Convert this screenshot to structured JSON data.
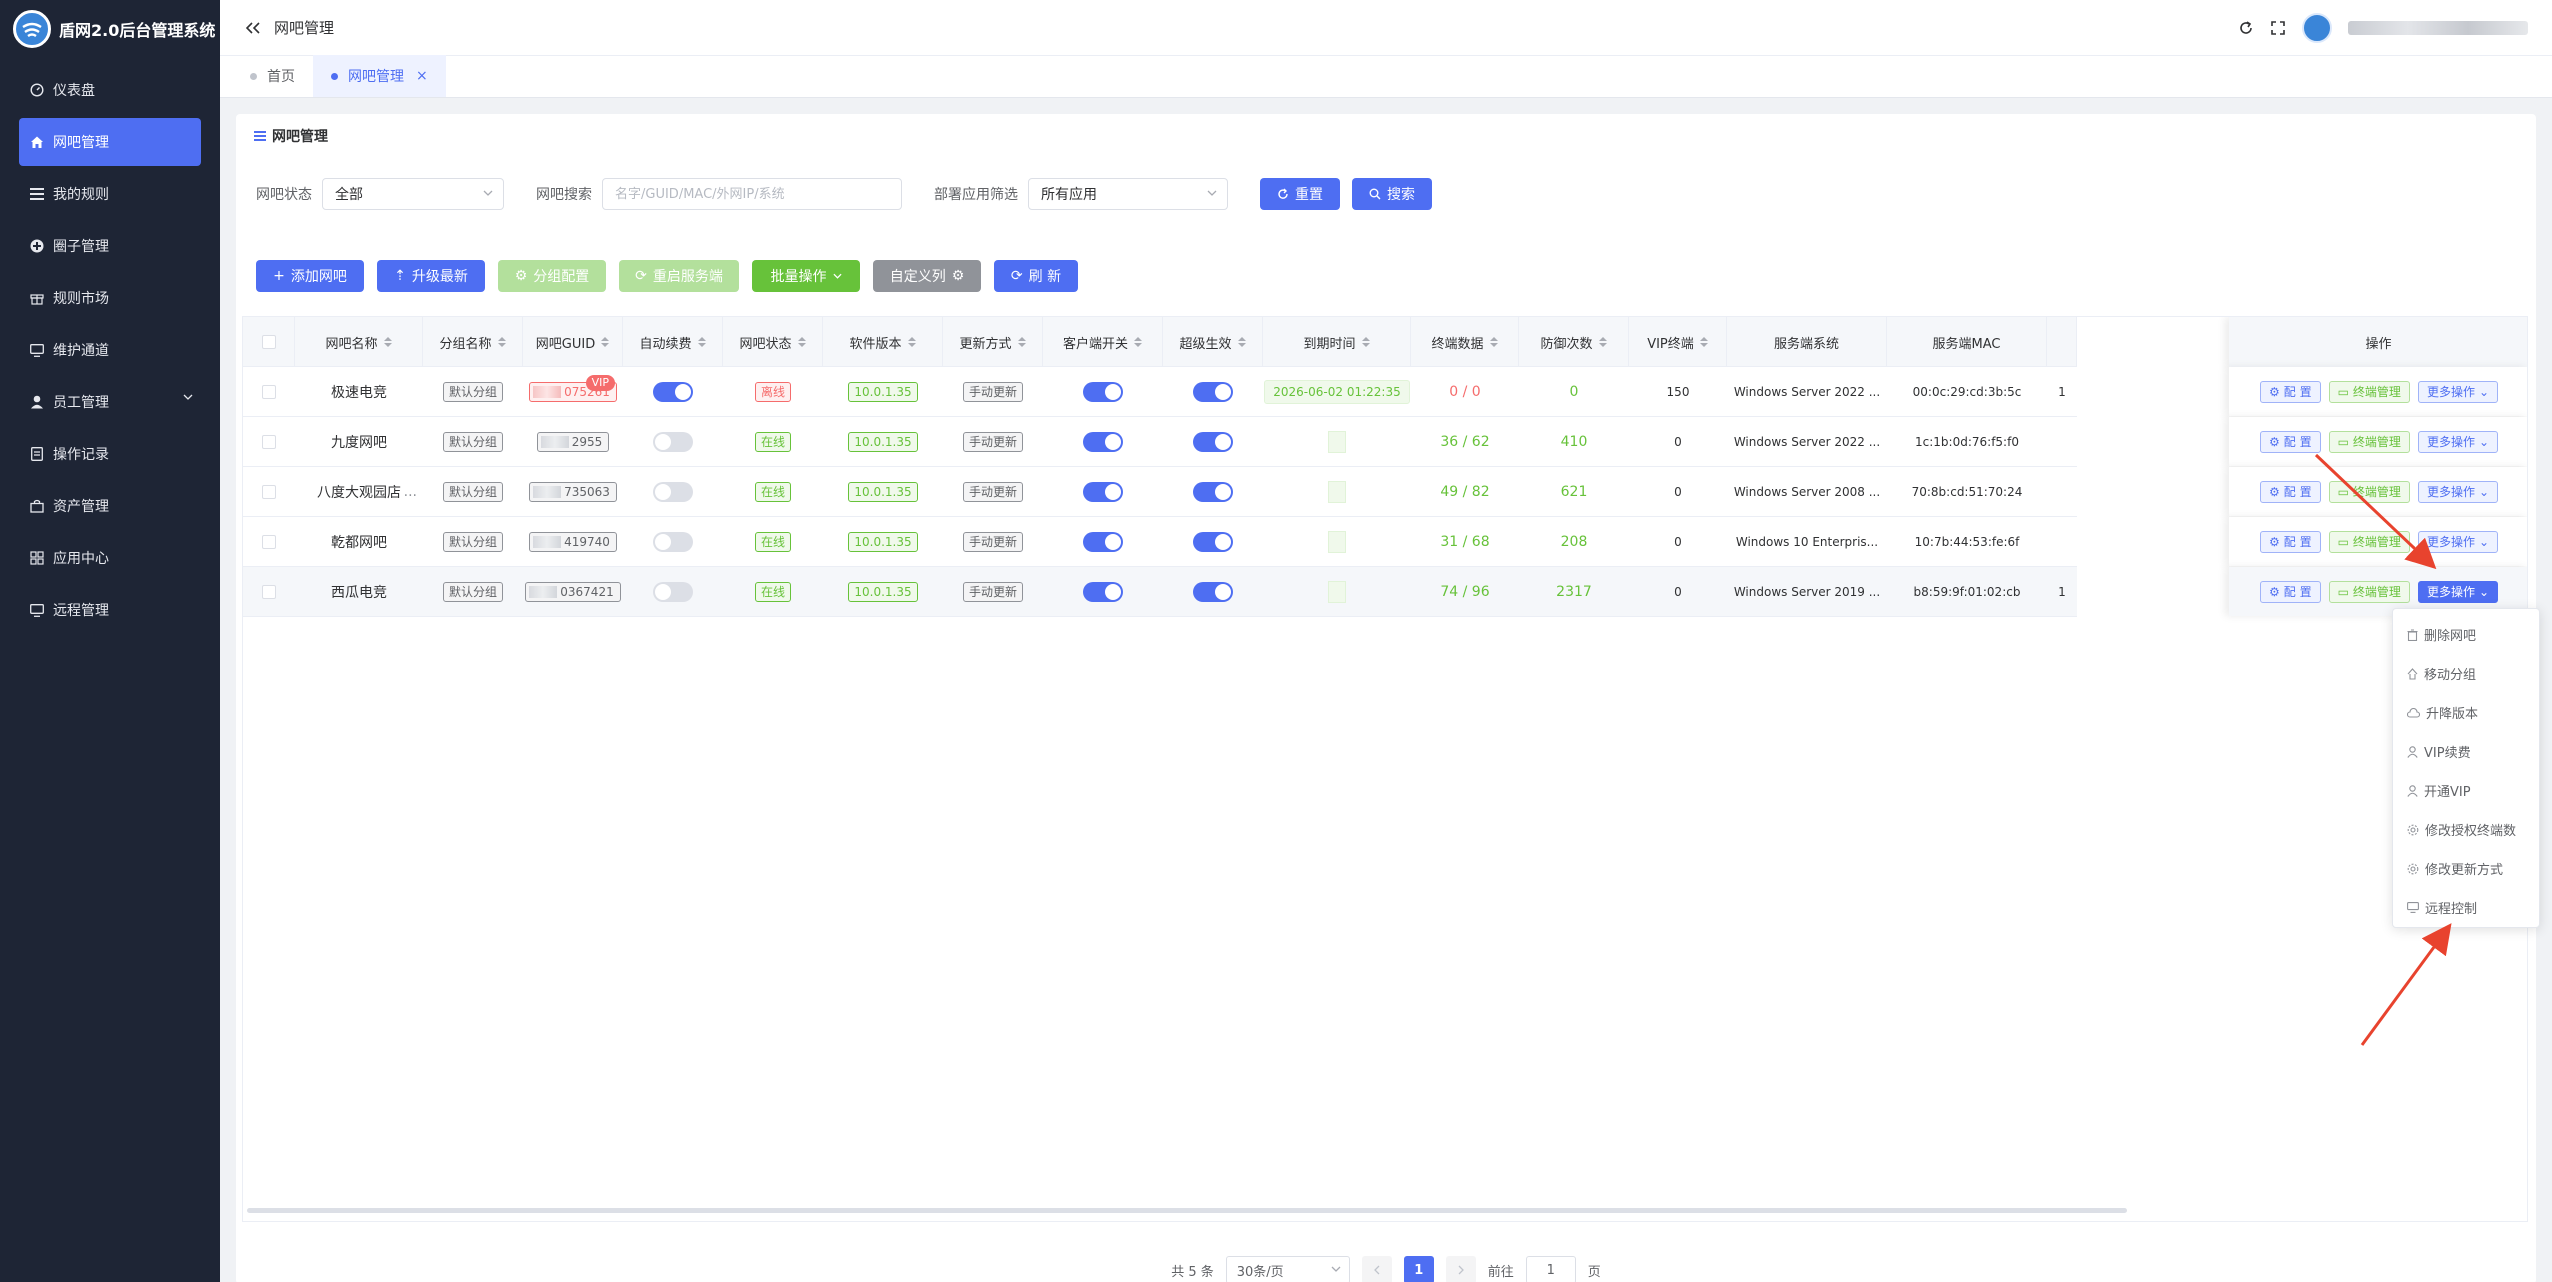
{
  "app": {
    "title": "盾网2.0后台管理系统"
  },
  "sidebar": {
    "items": [
      {
        "label": "仪表盘",
        "icon": "dashboard-icon"
      },
      {
        "label": "网吧管理",
        "icon": "home-icon",
        "active": true
      },
      {
        "label": "我的规则",
        "icon": "list-icon"
      },
      {
        "label": "圈子管理",
        "icon": "circle-plus-icon"
      },
      {
        "label": "规则市场",
        "icon": "gift-icon"
      },
      {
        "label": "维护通道",
        "icon": "monitor-icon"
      },
      {
        "label": "员工管理",
        "icon": "user-icon"
      },
      {
        "label": "操作记录",
        "icon": "document-icon"
      },
      {
        "label": "资产管理",
        "icon": "bag-icon"
      },
      {
        "label": "应用中心",
        "icon": "grid-icon"
      },
      {
        "label": "远程管理",
        "icon": "monitor-icon"
      }
    ]
  },
  "header": {
    "breadcrumb": "网吧管理"
  },
  "tabs": [
    {
      "label": "首页"
    },
    {
      "label": "网吧管理",
      "closable": "×"
    }
  ],
  "card": {
    "title": "网吧管理"
  },
  "filters": {
    "status_label": "网吧状态",
    "status_value": "全部",
    "search_label": "网吧搜索",
    "search_placeholder": "名字/GUID/MAC/外网IP/系统",
    "app_label": "部署应用筛选",
    "app_value": "所有应用",
    "reset": "重置",
    "search": "搜索"
  },
  "toolbar": {
    "add": "添加网吧",
    "upgrade": "升级最新",
    "group_config": "分组配置",
    "restart_server": "重启服务端",
    "batch": "批量操作",
    "custom_cols": "自定义列",
    "refresh": "刷 新"
  },
  "table": {
    "headers": [
      "网吧名称",
      "分组名称",
      "网吧GUID",
      "自动续费",
      "网吧状态",
      "软件版本",
      "更新方式",
      "客户端开关",
      "超级生效",
      "到期时间",
      "终端数据",
      "防御次数",
      "VIP终端",
      "服务端系统",
      "服务端MAC",
      "操作"
    ],
    "rows": [
      {
        "name": "极速电竞",
        "group": "默认分组",
        "guid": "075261",
        "vip": "VIP",
        "auto_renew": true,
        "status": "离线",
        "version": "10.0.1.35",
        "update": "手动更新",
        "client": true,
        "super": true,
        "expire": "2026-06-02 01:22:35",
        "terminals": "0 / 0",
        "defense": "0",
        "vip_terms": "150",
        "os": "Windows Server 2022 ...",
        "mac": "00:0c:29:cd:3b:5c",
        "extra": "1"
      },
      {
        "name": "九度网吧",
        "group": "默认分组",
        "guid": "2955",
        "auto_renew": false,
        "status": "在线",
        "version": "10.0.1.35",
        "update": "手动更新",
        "client": true,
        "super": true,
        "expire": "",
        "terminals": "36 / 62",
        "defense": "410",
        "vip_terms": "0",
        "os": "Windows Server 2022 ...",
        "mac": "1c:1b:0d:76:f5:f0",
        "extra": ""
      },
      {
        "name": "八度大观园店",
        "suffix": "...",
        "group": "默认分组",
        "guid": "735063",
        "auto_renew": false,
        "status": "在线",
        "version": "10.0.1.35",
        "update": "手动更新",
        "client": true,
        "super": true,
        "expire": "",
        "terminals": "49 / 82",
        "defense": "621",
        "vip_terms": "0",
        "os": "Windows Server 2008 ...",
        "mac": "70:8b:cd:51:70:24",
        "extra": ""
      },
      {
        "name": "乾都网吧",
        "group": "默认分组",
        "guid": "419740",
        "auto_renew": false,
        "status": "在线",
        "version": "10.0.1.35",
        "update": "手动更新",
        "client": true,
        "super": true,
        "expire": "",
        "terminals": "31 / 68",
        "defense": "208",
        "vip_terms": "0",
        "os": "Windows 10 Enterpris...",
        "mac": "10:7b:44:53:fe:6f",
        "extra": ""
      },
      {
        "name": "西瓜电竞",
        "group": "默认分组",
        "guid": "0367421",
        "auto_renew": false,
        "status": "在线",
        "version": "10.0.1.35",
        "update": "手动更新",
        "client": true,
        "super": true,
        "expire": "",
        "terminals": "74 / 96",
        "defense": "2317",
        "vip_terms": "0",
        "os": "Windows Server 2019 ...",
        "mac": "b8:59:9f:01:02:cb",
        "extra": "1"
      }
    ],
    "ops": {
      "config": "配 置",
      "terminal": "终端管理",
      "more": "更多操作"
    }
  },
  "dropdown": [
    {
      "label": "删除网吧",
      "icon": "trash-icon"
    },
    {
      "label": "移动分组",
      "icon": "move-icon"
    },
    {
      "label": "升降版本",
      "icon": "cloud-icon"
    },
    {
      "label": "VIP续费",
      "icon": "user-icon"
    },
    {
      "label": "开通VIP",
      "icon": "user-icon"
    },
    {
      "label": "修改授权终端数",
      "icon": "gear-icon"
    },
    {
      "label": "修改更新方式",
      "icon": "gear-icon"
    },
    {
      "label": "远程控制",
      "icon": "monitor-icon"
    }
  ],
  "pagination": {
    "total": "共 5 条",
    "page_size": "30条/页",
    "current": "1",
    "goto_label": "前往",
    "goto_value": "1",
    "page_suffix": "页"
  },
  "colors": {
    "primary": "#4e6ef2",
    "success": "#67c23a",
    "danger": "#f56c6c",
    "sidebar": "#1e2535",
    "annotation": "#e8432e"
  }
}
